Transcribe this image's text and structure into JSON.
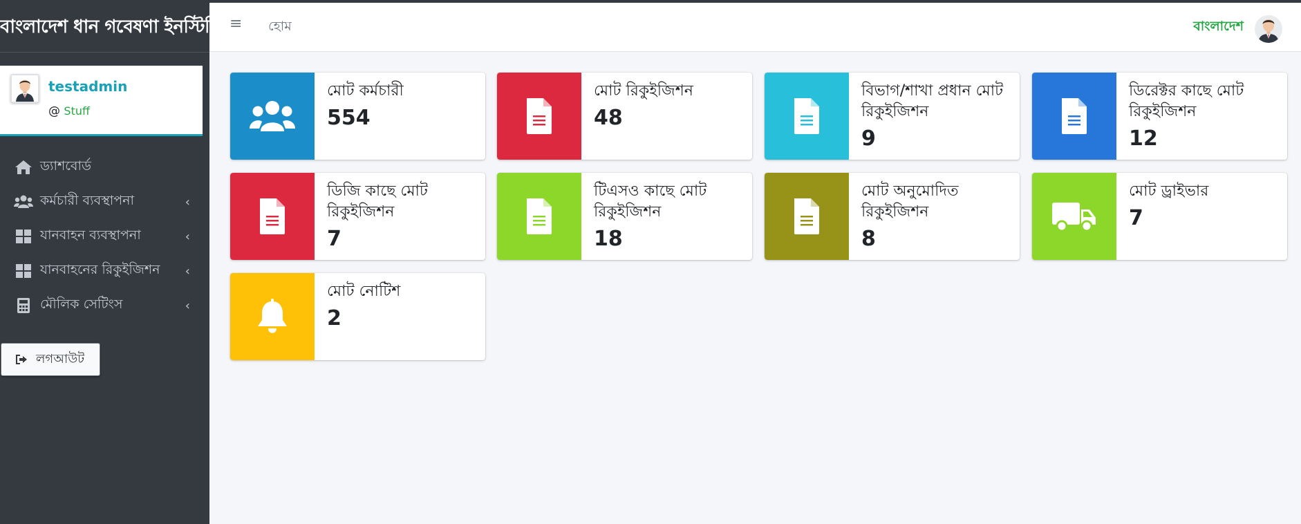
{
  "brand": {
    "title": "বাংলাদেশ ধান গবেষণা ইনস্টিটিউট"
  },
  "user": {
    "name": "testadmin",
    "at": "@",
    "role": "Stuff"
  },
  "sidebar": {
    "items": [
      {
        "label": "ড্যাশবোর্ড",
        "icon": "home-icon",
        "has_chevron": false
      },
      {
        "label": "কর্মচারী ব্যবস্থাপনা",
        "icon": "users-icon",
        "has_chevron": true
      },
      {
        "label": "যানবাহন ব্যবস্থাপনা",
        "icon": "grid-icon",
        "has_chevron": true
      },
      {
        "label": "যানবাহনের রিকুইজিশন",
        "icon": "grid-icon",
        "has_chevron": true
      },
      {
        "label": "মৌলিক সেটিংস",
        "icon": "calculator-icon",
        "has_chevron": true
      }
    ],
    "chevron": "‹",
    "logout_label": "লগআউট"
  },
  "navbar": {
    "menu_glyph": "≡",
    "home_label": "হোম",
    "language_label": "বাংলাদেশ"
  },
  "cards": [
    {
      "label": "মোট কর্মচারী",
      "value": "554",
      "color": "#1b8ec9",
      "icon": "users-icon"
    },
    {
      "label": "মোট রিকুইজিশন",
      "value": "48",
      "color": "#dc2940",
      "icon": "file-icon"
    },
    {
      "label": "বিভাগ/শাখা প্রধান মোট রিকুইজিশন",
      "value": "9",
      "color": "#27bfd9",
      "icon": "file-icon"
    },
    {
      "label": "ডিরেক্টর কাছে মোট রিকুইজিশন",
      "value": "12",
      "color": "#2777db",
      "icon": "file-icon"
    },
    {
      "label": "ডিজি কাছে মোট রিকুইজিশন",
      "value": "7",
      "color": "#dc2940",
      "icon": "file-icon"
    },
    {
      "label": "টিএসও কাছে মোট রিকুইজিশন",
      "value": "18",
      "color": "#8dd62a",
      "icon": "file-icon"
    },
    {
      "label": "মোট অনুমোদিত রিকুইজিশন",
      "value": "8",
      "color": "#979319",
      "icon": "file-icon"
    },
    {
      "label": "মোট ড্রাইভার",
      "value": "7",
      "color": "#8dd62a",
      "icon": "truck-icon"
    },
    {
      "label": "মোট নোটিশ",
      "value": "2",
      "color": "#ffc107",
      "icon": "bell-icon"
    }
  ]
}
